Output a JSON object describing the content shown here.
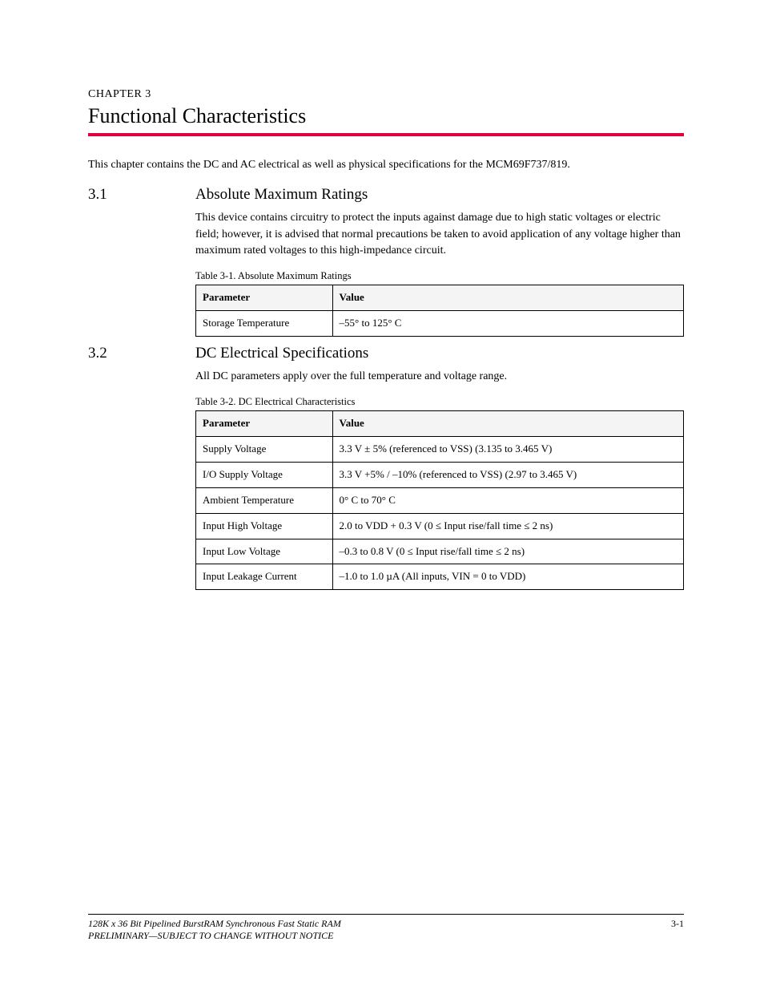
{
  "chapter": {
    "label": "CHAPTER 3",
    "title": "Functional Characteristics"
  },
  "intro": "This chapter contains the DC and AC electrical as well as physical specifications for the MCM69F737/819.",
  "sections": [
    {
      "num": "3.1",
      "title": "Absolute Maximum Ratings",
      "para": "This device contains circuitry to protect the inputs against damage due to high static voltages or electric field; however, it is advised that normal precautions be taken to avoid application of any voltage higher than maximum rated voltages to this high-impedance circuit.",
      "caption": "Table 3-1. Absolute Maximum Ratings",
      "table": {
        "headers": [
          "Parameter",
          "Value"
        ],
        "rows": [
          [
            "Storage Temperature",
            "–55° to 125° C"
          ]
        ]
      }
    },
    {
      "num": "3.2",
      "title": "DC Electrical Specifications",
      "para": "All DC parameters apply over the full temperature and voltage range.",
      "caption": "Table 3-2. DC Electrical Characteristics",
      "table": {
        "headers": [
          "Parameter",
          "Value"
        ],
        "rows": [
          [
            "Supply Voltage",
            "3.3 V ± 5% (referenced to VSS) (3.135 to 3.465 V)"
          ],
          [
            "I/O Supply Voltage",
            "3.3 V +5% / –10% (referenced to VSS) (2.97 to 3.465 V)"
          ],
          [
            "Ambient Temperature",
            "0° C to 70° C"
          ],
          [
            "Input High Voltage",
            "2.0 to VDD + 0.3 V (0 ≤ Input rise/fall time ≤ 2 ns)"
          ],
          [
            "Input Low Voltage",
            "–0.3 to 0.8 V (0 ≤ Input rise/fall time ≤ 2 ns)"
          ],
          [
            "Input Leakage Current",
            "–1.0 to 1.0 µA (All inputs, VIN = 0 to VDD)"
          ]
        ]
      }
    }
  ],
  "footer": {
    "left": "128K x 36 Bit Pipelined BurstRAM Synchronous Fast Static RAM",
    "right": "3-1",
    "sub": "PRELIMINARY—SUBJECT TO CHANGE WITHOUT NOTICE"
  }
}
